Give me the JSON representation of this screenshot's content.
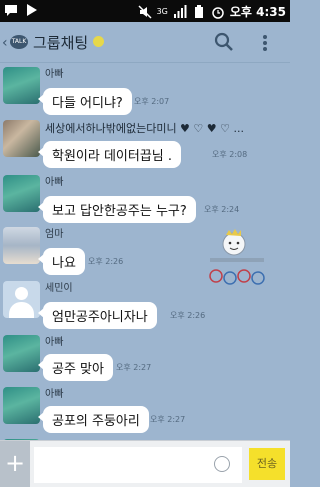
{
  "status_bar": {
    "network": "3G",
    "time": "오후 4:35"
  },
  "header": {
    "talk_badge": "TALK",
    "title": "그룹채팅"
  },
  "messages": [
    {
      "sender": "아빠",
      "text": "다들 어디냐?",
      "time": "오후 2:07"
    },
    {
      "sender": "세상에서하나밖에없는다미니 ♥ ♡ ♥ ♡ ...",
      "text": "학원이라 데이터끕님 .",
      "time": "오후 2:08"
    },
    {
      "sender": "아빠",
      "text": "보고 답안한공주는 누구?",
      "time": "오후 2:24"
    },
    {
      "sender": "엄마",
      "text": "나요",
      "time": "오후 2:26"
    },
    {
      "sender": "세민이",
      "text": "엄만공주아니자나",
      "time": "오후 2:26"
    },
    {
      "sender": "아빠",
      "text": "공주 맞아",
      "time": "오후 2:27"
    },
    {
      "sender": "아빠",
      "text": "공포의 주둥아리",
      "time": "오후 2:27"
    }
  ],
  "input_bar": {
    "placeholder": "",
    "send_label": "전송"
  },
  "colors": {
    "chat_background": "#9db5cf",
    "send_button": "#f5e02b"
  }
}
